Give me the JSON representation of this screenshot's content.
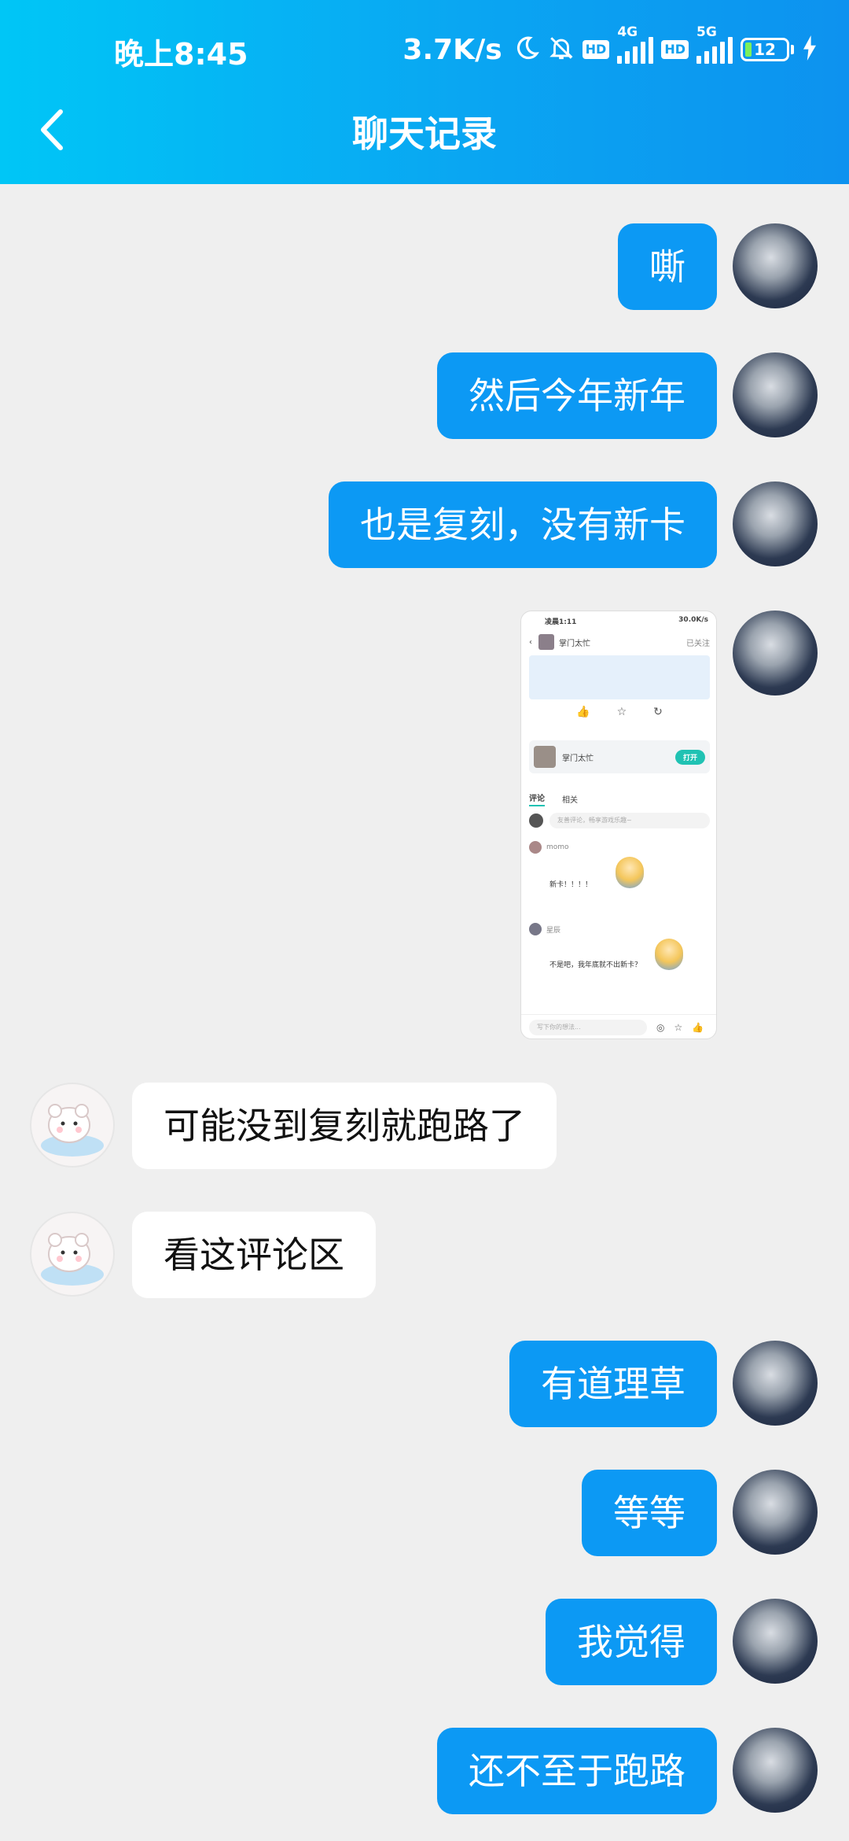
{
  "status_bar": {
    "time": "晚上8:45",
    "net_speed": "3.7K/s",
    "hd_label": "HD",
    "sim1_label": "4G",
    "sim2_label": "5G",
    "battery_level": "12"
  },
  "header": {
    "title": "聊天记录",
    "back_icon": "chevron-left-icon",
    "gradient_start": "#00c6f6",
    "gradient_end": "#0d92ef"
  },
  "colors": {
    "my_bubble": "#0c99f4",
    "other_bubble": "#ffffff",
    "background": "#efefef"
  },
  "messages": [
    {
      "sender": "me",
      "text": "嘶"
    },
    {
      "sender": "me",
      "text": "然后今年新年"
    },
    {
      "sender": "me",
      "text": "也是复刻，没有新卡"
    },
    {
      "sender": "me",
      "type": "image"
    },
    {
      "sender": "other",
      "text": "可能没到复刻就跑路了"
    },
    {
      "sender": "other",
      "text": "看这评论区"
    },
    {
      "sender": "me",
      "text": "有道理草"
    },
    {
      "sender": "me",
      "text": "等等"
    },
    {
      "sender": "me",
      "text": "我觉得"
    },
    {
      "sender": "me",
      "text": "还不至于跑路"
    }
  ],
  "screenshot_preview": {
    "time": "凌晨1:11",
    "speed": "30.0K/s",
    "account_name": "掌门太忙",
    "follow_status": "已关注",
    "app_card_name": "掌门太忙",
    "open_button": "打开",
    "tab_comments": "评论",
    "tab_related": "相关",
    "comment_placeholder": "友善评论，畅享游戏乐趣~",
    "comment1_user": "momo",
    "comment1_text": "新卡！！！！",
    "comment2_user": "星辰",
    "comment2_text": "不是吧，我年底就不出新卡？",
    "bottom_placeholder": "写下你的想法..."
  }
}
